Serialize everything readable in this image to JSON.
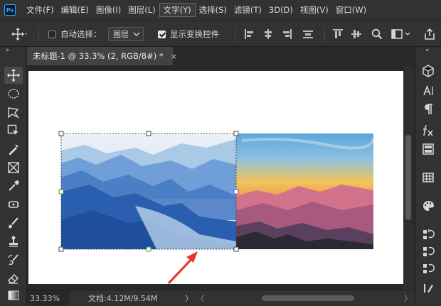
{
  "app": {
    "logo_text": "Ps"
  },
  "menubar": {
    "items": [
      "文件(F)",
      "编辑(E)",
      "图像(I)",
      "图层(L)",
      "文字(Y)",
      "选择(S)",
      "滤镜(T)",
      "3D(D)",
      "视图(V)",
      "窗口(W)"
    ],
    "active_index": 4
  },
  "options": {
    "auto_select_label": "自动选择：",
    "auto_select_checked": false,
    "layer_select_value": "图层",
    "show_transform_label": "显示变换控件",
    "show_transform_checked": true
  },
  "tab": {
    "title": "未标题-1 @ 33.3% (2, RGB/8#) *",
    "close_glyph": "×"
  },
  "statusbar": {
    "zoom": "33.33%",
    "doc_info": "文档:4.12M/9.54M",
    "arrow": "〉",
    "left": "〈",
    "right": "〉"
  },
  "colors": {
    "accent_arrow": "#e8392b",
    "ps_blue": "#31a8ff"
  }
}
